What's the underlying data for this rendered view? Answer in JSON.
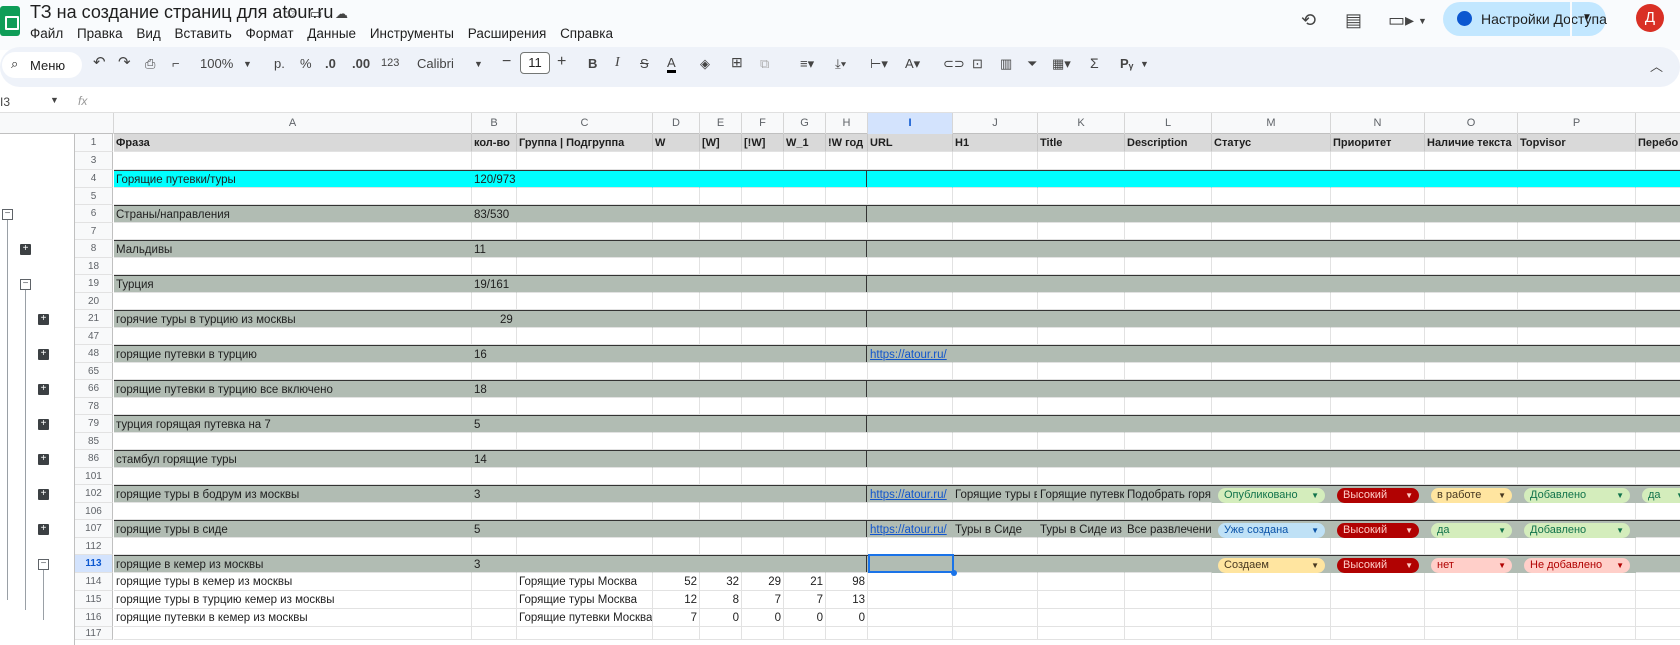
{
  "app": {
    "title": "ТЗ на создание страниц для atour.ru",
    "menu": [
      "Файл",
      "Правка",
      "Вид",
      "Вставить",
      "Формат",
      "Данные",
      "Инструменты",
      "Расширения",
      "Справка"
    ],
    "share_label": "Настройки Доступа",
    "avatar_letter": "Д"
  },
  "toolbar": {
    "menu_search": "Меню",
    "zoom": "100%",
    "currency": "р.",
    "percent": "%",
    "dec_less": ".0",
    "dec_more": ".00",
    "num_format": "123",
    "font": "Calibri",
    "font_size": "11",
    "bold": "B",
    "italic": "I",
    "strike": "S",
    "text_color": "A",
    "function": "Σ",
    "script": "Pᵧ"
  },
  "formula_bar": {
    "cell_ref": "I3",
    "fx": "fx"
  },
  "columns": [
    "A",
    "B",
    "C",
    "D",
    "E",
    "F",
    "G",
    "H",
    "I",
    "J",
    "K",
    "L",
    "M",
    "N",
    "O",
    "P",
    ""
  ],
  "header": [
    "Фраза",
    "кол-во",
    "Группа | Подгруппа",
    "W",
    "[W]",
    "[!W]",
    "W_1",
    "!W год",
    "URL",
    "H1",
    "Title",
    "Description",
    "Статус",
    "Приоритет",
    "Наличие текста",
    "Topvisor",
    "Перебо"
  ],
  "rows": [
    {
      "n": "1"
    },
    {
      "n": "3"
    },
    {
      "n": "4",
      "a": "Горящие путевки/туры",
      "b": "120/973"
    },
    {
      "n": "5"
    },
    {
      "n": "6",
      "a": "Страны/направления",
      "b": "83/530"
    },
    {
      "n": "7"
    },
    {
      "n": "8",
      "a": "Мальдивы",
      "b": "11"
    },
    {
      "n": "18"
    },
    {
      "n": "19",
      "a": "Турция",
      "b": "19/161"
    },
    {
      "n": "20"
    },
    {
      "n": "21",
      "a": "горячие туры в турцию из москвы",
      "b": "29"
    },
    {
      "n": "47"
    },
    {
      "n": "48",
      "a": "горящие путевки в турцию",
      "b": "16",
      "i": "https://atour.ru/"
    },
    {
      "n": "65"
    },
    {
      "n": "66",
      "a": "горящие путевки в турцию все включено",
      "b": "18"
    },
    {
      "n": "78"
    },
    {
      "n": "79",
      "a": "турция горящая путевка на 7",
      "b": "5"
    },
    {
      "n": "85"
    },
    {
      "n": "86",
      "a": "стамбул горящие туры",
      "b": "14"
    },
    {
      "n": "101"
    },
    {
      "n": "102",
      "a": "горящие туры в бодрум из москвы",
      "b": "3",
      "i": "https://atour.ru/",
      "j": "Горящие туры в",
      "k": "Горящие путевк",
      "l": "Подобрать горя",
      "m": "Опубликовано",
      "nn": "Высокий",
      "o": "в работе",
      "p": "Добавлено",
      "q": "да"
    },
    {
      "n": "106"
    },
    {
      "n": "107",
      "a": "горящие туры в сиде",
      "b": "5",
      "i": "https://atour.ru/",
      "j": "Туры в Сиде",
      "k": "Туры в Сиде из",
      "l": "Все развлечени",
      "m": "Уже создана",
      "nn": "Высокий",
      "o": "да",
      "p": "Добавлено"
    },
    {
      "n": "112"
    },
    {
      "n": "113",
      "a": "горящие в кемер из москвы",
      "b": "3",
      "m": "Создаем",
      "nn": "Высокий",
      "o": "нет",
      "p": "Не добавлено"
    },
    {
      "n": "114",
      "a": "горящие туры в кемер из москвы",
      "c": "Горящие туры Москва",
      "d": "52",
      "e": "32",
      "f": "29",
      "g": "21",
      "h": "98"
    },
    {
      "n": "115",
      "a": "горящие туры в турцию кемер из москвы",
      "c": "Горящие туры Москва",
      "d": "12",
      "e": "8",
      "f": "7",
      "g": "7",
      "h": "13"
    },
    {
      "n": "116",
      "a": "горящие путевки в кемер из москвы",
      "c": "Горящие путевки Москва",
      "d": "7",
      "e": "0",
      "f": "0",
      "g": "0",
      "h": "0"
    },
    {
      "n": "117"
    }
  ],
  "colors": {
    "cyan": "#00ffff",
    "band": "#b1bcb3",
    "chip_green": "#d4edbc",
    "chip_red": "#b10202",
    "chip_blue": "#bfe1f6",
    "chip_yellow": "#ffe5a0",
    "chip_pink": "#ffcfc9"
  }
}
